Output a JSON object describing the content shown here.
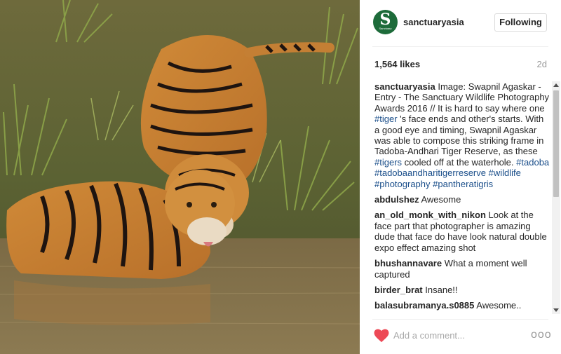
{
  "account": {
    "username": "sanctuaryasia",
    "avatar_letter": "S",
    "avatar_subtext": "Sanctuary",
    "follow_label": "Following"
  },
  "stats": {
    "likes": "1,564 likes",
    "age": "2d"
  },
  "caption": {
    "user": "sanctuaryasia",
    "text_before_tag": "Image: Swapnil Agaskar - Entry - The Sanctuary Wildlife Photography Awards 2016 // It is hard to say where one",
    "tag_inline_1": "#tiger",
    "text_middle": "'s face ends and other's starts. With a good eye and timing, Swapnil Agaskar was able to compose this striking frame in Tadoba-Andhari Tiger Reserve, as these",
    "tag_inline_2": "#tigers",
    "text_after": "cooled off at the waterhole.",
    "hashtags": [
      "#tadoba",
      "#tadobaandharitigerreserve",
      "#wildlife",
      "#photography",
      "#pantheratigris"
    ]
  },
  "comments": [
    {
      "user": "abdulshez",
      "text": "Awesome"
    },
    {
      "user": "an_old_monk_with_nikon",
      "text": "Look at the face part that photographer is amazing dude that face do have look natural double expo effect amazing shot"
    },
    {
      "user": "bhushannavare",
      "text": "What a moment well captured"
    },
    {
      "user": "birder_brat",
      "text": "Insane!!"
    },
    {
      "user": "balasubramanya.s0885",
      "text": "Awesome.."
    }
  ],
  "composer": {
    "placeholder": "Add a comment...",
    "more_label": "ooo"
  },
  "colors": {
    "link_blue": "#1a4e8a",
    "heart_red": "#ed4956",
    "avatar_green": "#1d6b3a",
    "muted_gray": "#999999"
  },
  "icons": {
    "like": "heart-icon",
    "more": "more-options-icon"
  }
}
